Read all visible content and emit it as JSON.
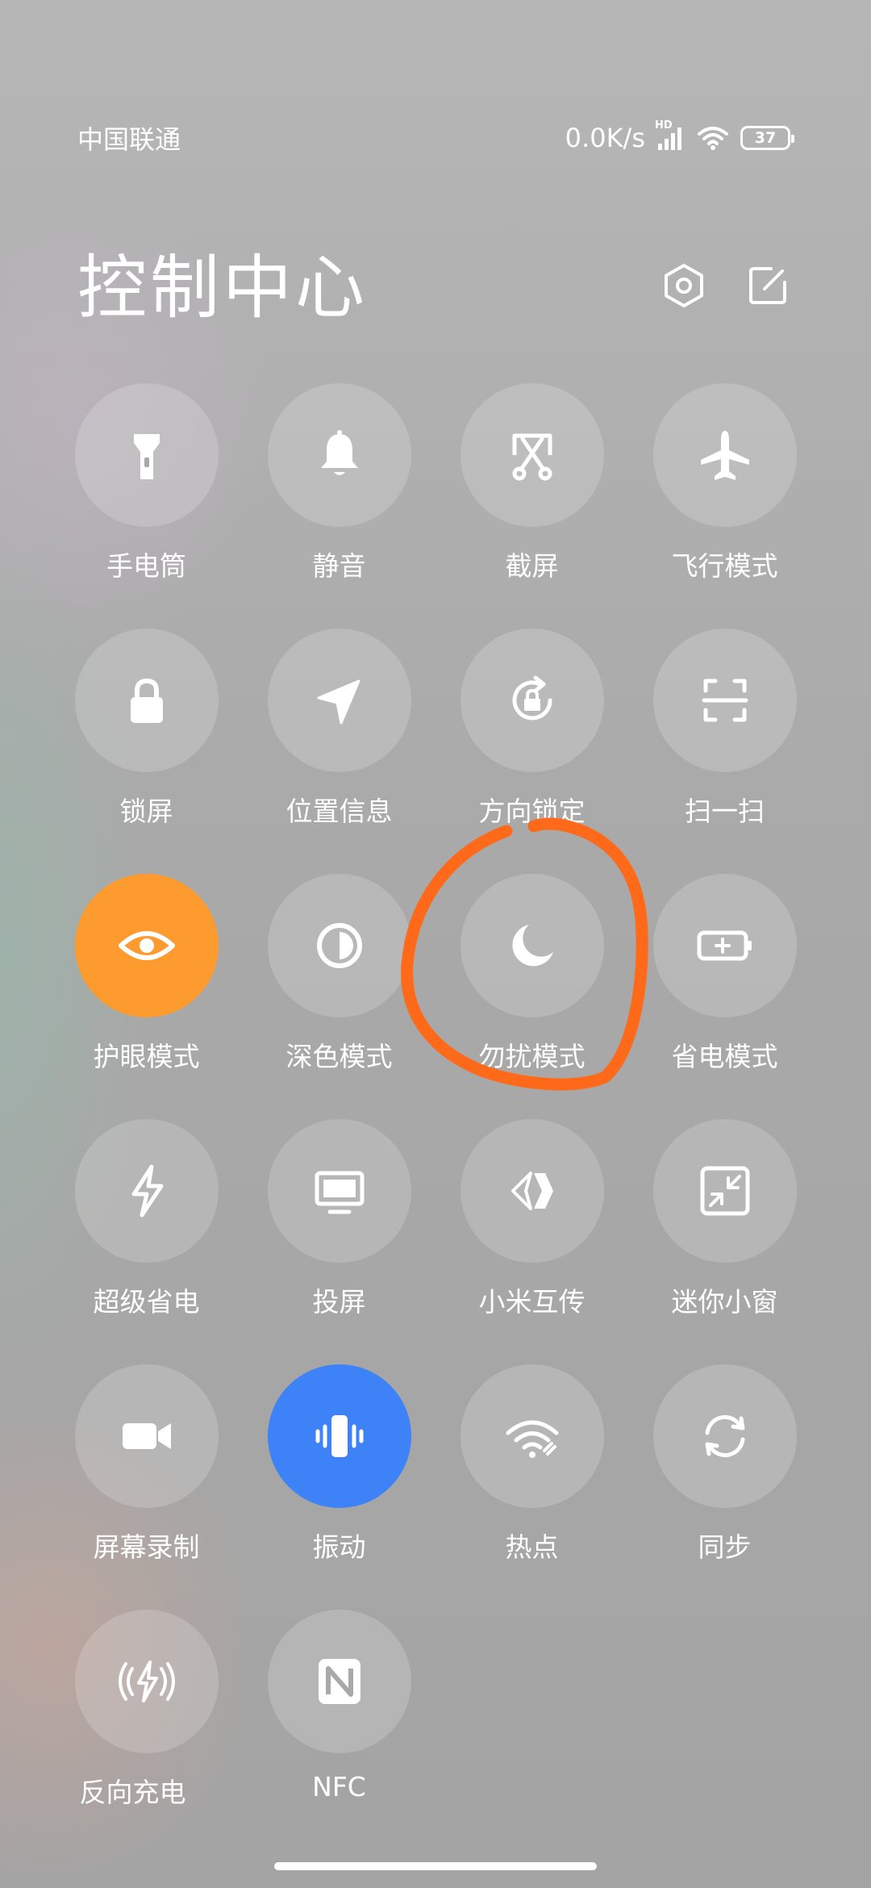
{
  "status_bar": {
    "carrier": "中国联通",
    "net_speed": "0.0K/s",
    "network_badge": "HD",
    "battery": "37",
    "icons": [
      "signal-icon",
      "wifi-icon",
      "battery-icon"
    ]
  },
  "header": {
    "title": "控制中心",
    "icons": [
      "settings-icon",
      "edit-icon"
    ]
  },
  "colors": {
    "active_orange": "#fe9b2e",
    "active_blue": "#3d82f7",
    "annotation": "#ff6a1a",
    "tile_inactive": "rgba(255,255,255,0.18)"
  },
  "tiles": [
    {
      "label": "手电筒",
      "icon": "flashlight-icon",
      "active": false
    },
    {
      "label": "静音",
      "icon": "bell-icon",
      "active": false
    },
    {
      "label": "截屏",
      "icon": "screenshot-icon",
      "active": false
    },
    {
      "label": "飞行模式",
      "icon": "airplane-icon",
      "active": false
    },
    {
      "label": "锁屏",
      "icon": "lock-icon",
      "active": false
    },
    {
      "label": "位置信息",
      "icon": "location-icon",
      "active": false
    },
    {
      "label": "方向锁定",
      "icon": "rotation-lock-icon",
      "active": false
    },
    {
      "label": "扫一扫",
      "icon": "scan-icon",
      "active": false
    },
    {
      "label": "护眼模式",
      "icon": "eye-icon",
      "active": true
    },
    {
      "label": "深色模式",
      "icon": "dark-mode-icon",
      "active": false
    },
    {
      "label": "勿扰模式",
      "icon": "moon-icon",
      "active": false
    },
    {
      "label": "省电模式",
      "icon": "battery-saver-icon",
      "active": false
    },
    {
      "label": "超级省电",
      "icon": "lightning-icon",
      "active": false
    },
    {
      "label": "投屏",
      "icon": "monitor-icon",
      "active": false
    },
    {
      "label": "小米互传",
      "icon": "share-icon",
      "active": false
    },
    {
      "label": "迷你小窗",
      "icon": "mini-window-icon",
      "active": false
    },
    {
      "label": "屏幕录制",
      "icon": "video-camera-icon",
      "active": false
    },
    {
      "label": "振动",
      "icon": "vibrate-icon",
      "active": true
    },
    {
      "label": "热点",
      "icon": "hotspot-icon",
      "active": false
    },
    {
      "label": "同步",
      "icon": "sync-icon",
      "active": false
    },
    {
      "label": "反向充电",
      "icon": "reverse-charge-icon",
      "active": false
    },
    {
      "label": "NFC",
      "icon": "nfc-icon",
      "active": false
    }
  ]
}
